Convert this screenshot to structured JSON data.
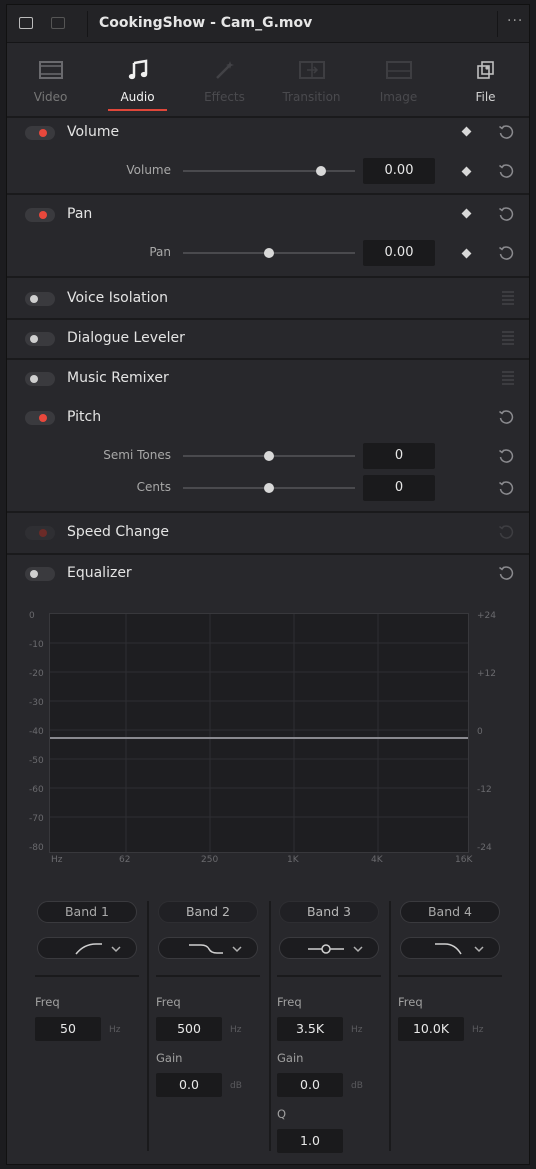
{
  "title_bar": {
    "clip_name": "CookingShow - Cam_G.mov",
    "more_label": "···"
  },
  "tabs": [
    {
      "label": "Video",
      "icon": "video-icon",
      "state": "inactive"
    },
    {
      "label": "Audio",
      "icon": "music-note-icon",
      "state": "active"
    },
    {
      "label": "Effects",
      "icon": "magic-wand-icon",
      "state": "disabled"
    },
    {
      "label": "Transition",
      "icon": "transition-icon",
      "state": "disabled"
    },
    {
      "label": "Image",
      "icon": "image-icon",
      "state": "disabled"
    },
    {
      "label": "File",
      "icon": "file-icon",
      "state": "inactive"
    }
  ],
  "sections": {
    "volume": {
      "label": "Volume",
      "enabled": true,
      "param_label": "Volume",
      "value": "0.00",
      "slider_fraction": 0.8
    },
    "pan": {
      "label": "Pan",
      "enabled": true,
      "param_label": "Pan",
      "value": "0.00",
      "slider_fraction": 0.5
    },
    "voice_isolation": {
      "label": "Voice Isolation",
      "enabled": false
    },
    "dialogue_leveler": {
      "label": "Dialogue Leveler",
      "enabled": false
    },
    "music_remixer": {
      "label": "Music Remixer",
      "enabled": false
    },
    "pitch": {
      "label": "Pitch",
      "enabled": true,
      "semi_tones_label": "Semi Tones",
      "semi_tones_value": "0",
      "semi_tones_fraction": 0.5,
      "cents_label": "Cents",
      "cents_value": "0",
      "cents_fraction": 0.5
    },
    "speed_change": {
      "label": "Speed Change",
      "enabled": false
    },
    "equalizer": {
      "label": "Equalizer",
      "enabled": false
    }
  },
  "equalizer_graph": {
    "left_scale": [
      "0",
      "-10",
      "-20",
      "-30",
      "-40",
      "-50",
      "-60",
      "-70",
      "-80"
    ],
    "right_scale": [
      "+24",
      "+12",
      "0",
      "-12",
      "-24"
    ],
    "freq_scale": [
      "Hz",
      "62",
      "250",
      "1K",
      "4K",
      "16K"
    ]
  },
  "bands": [
    {
      "label": "Band 1",
      "shape": "high-pass-icon",
      "freq_label": "Freq",
      "freq": "50",
      "freq_unit": "Hz"
    },
    {
      "label": "Band 2",
      "shape": "low-shelf-icon",
      "freq_label": "Freq",
      "freq": "500",
      "freq_unit": "Hz",
      "gain_label": "Gain",
      "gain": "0.0",
      "gain_unit": "dB"
    },
    {
      "label": "Band 3",
      "shape": "bell-icon",
      "freq_label": "Freq",
      "freq": "3.5K",
      "freq_unit": "Hz",
      "gain_label": "Gain",
      "gain": "0.0",
      "gain_unit": "dB",
      "q_label": "Q",
      "q": "1.0"
    },
    {
      "label": "Band 4",
      "shape": "low-pass-icon",
      "freq_label": "Freq",
      "freq": "10.0K",
      "freq_unit": "Hz"
    }
  ],
  "colors": {
    "accent": "#e0473a",
    "toggle_on": "#e8483c",
    "background": "#28282c"
  }
}
